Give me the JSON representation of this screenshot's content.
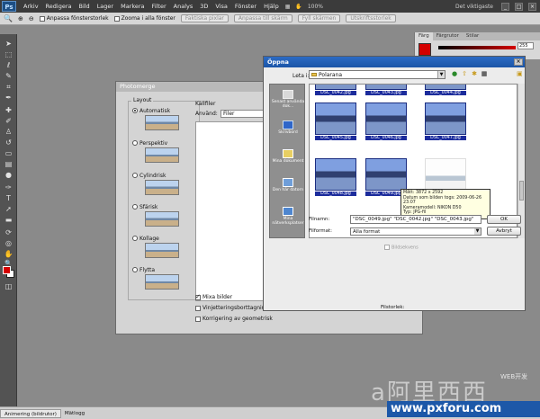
{
  "app": {
    "logo": "Ps",
    "menus": [
      "Arkiv",
      "Redigera",
      "Bild",
      "Lager",
      "Markera",
      "Filter",
      "Analys",
      "3D",
      "Visa",
      "Fönster",
      "Hjälp"
    ],
    "zoom": "100%",
    "workspace": "Det viktigaste"
  },
  "options_bar": {
    "resize_windows": "Anpassa fönsterstorlek",
    "zoom_all": "Zooma i alla fönster",
    "actual_pixels": "Faktiska pixlar",
    "fit_screen": "Anpassa till skärm",
    "fill_screen": "Fyll skärmen",
    "print_size": "Utskriftsstorlek"
  },
  "color_panel": {
    "tabs": [
      "Färg",
      "Färgrutor",
      "Stilar"
    ],
    "value": "255",
    "fg_color": "#d40000"
  },
  "photomerge": {
    "title": "Photomerge",
    "layout_title": "Layout",
    "layouts": [
      {
        "label": "Automatisk",
        "selected": true
      },
      {
        "label": "Perspektiv",
        "selected": false
      },
      {
        "label": "Cylindrisk",
        "selected": false
      },
      {
        "label": "Sfärisk",
        "selected": false
      },
      {
        "label": "Kollage",
        "selected": false
      },
      {
        "label": "Flytta",
        "selected": false
      }
    ],
    "source_title": "Källfiler",
    "use_label": "Använd:",
    "use_value": "Filer",
    "checkboxes": [
      {
        "label": "Mixa bilder",
        "checked": true
      },
      {
        "label": "Vinjetteringsborttagning",
        "checked": false
      },
      {
        "label": "Korrigering av geometrisk",
        "checked": false
      }
    ]
  },
  "open_dialog": {
    "title": "Öppna",
    "lookin_label": "Leta i:",
    "lookin_value": "Polarana",
    "places": [
      "Senast använda dok...",
      "Skrivbord",
      "Mina dokument",
      "Den här datorn",
      "Mina nätverksplatser"
    ],
    "files": [
      {
        "name": "DSC_0042.jpg"
      },
      {
        "name": "DSC_0043.jpg"
      },
      {
        "name": "DSC_0044.jpg"
      },
      {
        "name": "DSC_0045.jpg"
      },
      {
        "name": "DSC_0046.jpg"
      },
      {
        "name": "DSC_0047.jpg"
      },
      {
        "name": "DSC_0048.jpg"
      },
      {
        "name": "DSC_0049.jpg"
      },
      {
        "name": ""
      }
    ],
    "tooltip": [
      "Mått: 3872 x 2592",
      "Datum som bilden togs: 2009-06-26 23:07",
      "Kameramodell: NIKON D50",
      "Typ: JPG-fil",
      "Storlek: 3,77 MB"
    ],
    "filename_label": "Filnamn:",
    "filename_value": "\"DSC_0049.jpg\" \"DSC_0042.jpg\" \"DSC_0043.jpg\"",
    "filetype_label": "Filformat:",
    "filetype_value": "Alla format",
    "ok": "OK",
    "cancel": "Avbryt",
    "image_sequence": "Bildsekvens",
    "file_size_label": "Filstorlek:"
  },
  "status_bar": {
    "tabs": [
      "Animering (bildrutor)",
      "Mätlogg"
    ]
  },
  "watermark": {
    "logo": "a阿里西西",
    "url": "www.pxforu.com",
    "small": "WEB开发"
  }
}
